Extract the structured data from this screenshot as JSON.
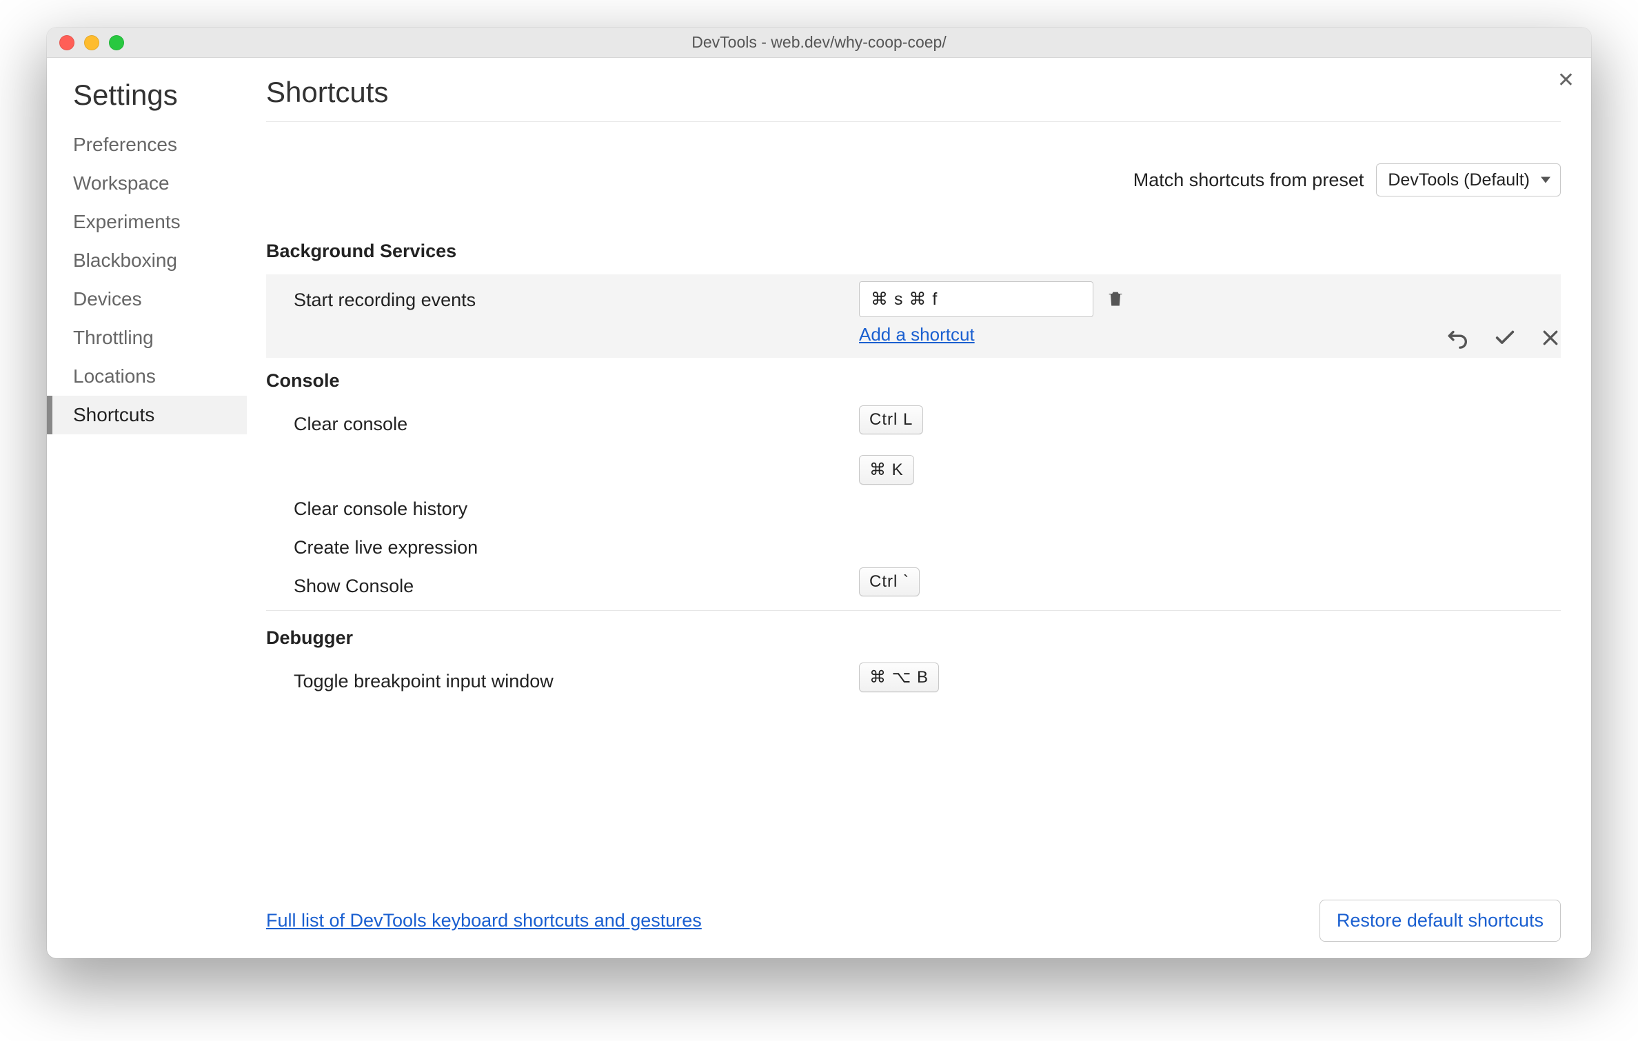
{
  "window": {
    "title": "DevTools - web.dev/why-coop-coep/"
  },
  "sidebar": {
    "heading": "Settings",
    "items": [
      {
        "label": "Preferences"
      },
      {
        "label": "Workspace"
      },
      {
        "label": "Experiments"
      },
      {
        "label": "Blackboxing"
      },
      {
        "label": "Devices"
      },
      {
        "label": "Throttling"
      },
      {
        "label": "Locations"
      },
      {
        "label": "Shortcuts"
      }
    ],
    "active_index": 7
  },
  "main": {
    "heading": "Shortcuts",
    "preset_label": "Match shortcuts from preset",
    "preset_value": "DevTools (Default)"
  },
  "sections": [
    {
      "title": "Background Services",
      "rows": [
        {
          "label": "Start recording events",
          "editing": true,
          "chord_value": "⌘ s ⌘ f",
          "add_link": "Add a shortcut"
        }
      ]
    },
    {
      "title": "Console",
      "rows": [
        {
          "label": "Clear console",
          "shortcuts": [
            "Ctrl L",
            "⌘ K"
          ]
        },
        {
          "label": "Clear console history",
          "shortcuts": []
        },
        {
          "label": "Create live expression",
          "shortcuts": []
        },
        {
          "label": "Show Console",
          "shortcuts": [
            "Ctrl `"
          ]
        }
      ]
    },
    {
      "title": "Debugger",
      "rows": [
        {
          "label": "Toggle breakpoint input window",
          "shortcuts": [
            "⌘ ⌥ B"
          ]
        }
      ]
    }
  ],
  "footer": {
    "link_text": "Full list of DevTools keyboard shortcuts and gestures",
    "restore_label": "Restore default shortcuts"
  }
}
